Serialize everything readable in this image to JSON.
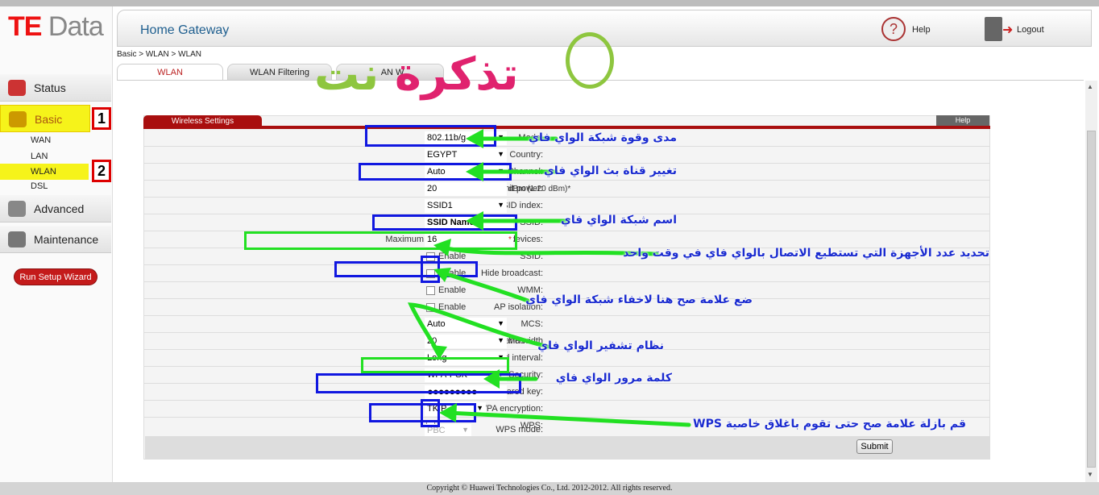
{
  "logo": {
    "te": "TE",
    "data": "Data"
  },
  "header": {
    "title": "Home Gateway",
    "help": "Help",
    "logout": "Logout"
  },
  "sidebar": {
    "items": [
      {
        "label": "Status"
      },
      {
        "label": "Basic"
      },
      {
        "label": "Advanced"
      },
      {
        "label": "Maintenance"
      }
    ],
    "sub_items": [
      {
        "label": "WAN"
      },
      {
        "label": "LAN"
      },
      {
        "label": "WLAN"
      },
      {
        "label": "DSL"
      }
    ],
    "wizard": "Run Setup Wizard",
    "step_badges": [
      "1",
      "2"
    ]
  },
  "breadcrumb": "Basic > WLAN > WLAN",
  "tabs": [
    {
      "label": "WLAN"
    },
    {
      "label": "WLAN Filtering"
    },
    {
      "label": "AN W..."
    }
  ],
  "panel": {
    "title": "Wireless Settings",
    "help": "Help"
  },
  "form": {
    "mode": {
      "label": "Mode:",
      "value": "802.11b/g"
    },
    "country": {
      "label": "Country:",
      "value": "EGYPT"
    },
    "channel": {
      "label": "Channel:",
      "value": "Auto"
    },
    "transmit_power": {
      "label": "Transmit power:",
      "value": "20",
      "unit": "dBm (1-20 dBm)*"
    },
    "ssid_index": {
      "label": "SSID index:",
      "value": "SSID1"
    },
    "ssid": {
      "label": "SSID:",
      "value": "SSID Name"
    },
    "max_devices": {
      "label": "Maximum number of accessing devices:",
      "value": "16",
      "required": "*"
    },
    "ssid_enable": {
      "label": "SSID:",
      "option": "Enable",
      "checked": false
    },
    "hide_broadcast": {
      "label": "Hide broadcast:",
      "option": "Enable",
      "checked": false
    },
    "wmm": {
      "label": "WMM:",
      "option": "Enable",
      "checked": false
    },
    "ap_isolation": {
      "label": "AP isolation:",
      "option": "Enable",
      "checked": false
    },
    "mcs": {
      "label": "MCS:",
      "value": "Auto"
    },
    "band_width": {
      "label": "Band width",
      "value": "20",
      "unit": "MHz"
    },
    "guard_interval": {
      "label": "Guard interval:",
      "value": "Long"
    },
    "security": {
      "label": "Security:",
      "value": "WPA-PSK"
    },
    "wpa_key": {
      "label": "WPA pre-shared key:",
      "value": "●●●●●●●●●"
    },
    "wpa_encryption": {
      "label": "WPA encryption:",
      "value": "TKIP"
    },
    "wps": {
      "label": "WPS:",
      "checked": false
    },
    "wps_mode": {
      "label": "WPS mode:",
      "value": "PBC"
    },
    "submit": "Submit"
  },
  "watermark": {
    "part1": "تذكرة",
    "part2": "نت"
  },
  "annotations": [
    "مدى وقوة شبكة الواي فاي",
    "تغيير قناة بث الواي فاي",
    "اسم شبكة الواي فاي",
    "تحديد عدد الأجهزة التي تستطيع الاتصال بالواي فاي في وقت واحد",
    "ضع علامة صح هنا لاخفاء شبكة الواي فاي",
    "نظام تشفير الواي فاي",
    "كلمة مرور الواي فاي",
    "قم بازلة علامة صح حتى تقوم باغلاق خاصية WPS"
  ],
  "footer": "Copyright © Huawei Technologies Co., Ltd. 2012-2012. All rights reserved.",
  "colors": {
    "accent": "#a90f0f",
    "highlight": "#f6f31a",
    "annotation_box": "#1017e0",
    "annotation_arrow": "#22e022"
  }
}
